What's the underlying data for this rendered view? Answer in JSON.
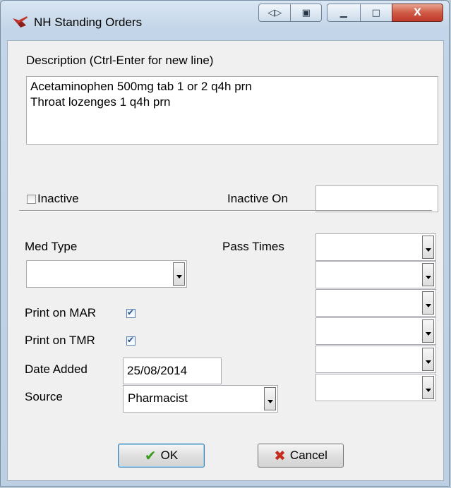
{
  "window": {
    "title": "NH Standing Orders",
    "buttons": {
      "restore_split": "◁▷",
      "copy": "▣",
      "minimize": "▁",
      "maximize": "□",
      "close": "X"
    }
  },
  "description": {
    "label": "Description  (Ctrl-Enter for new line)",
    "lines": [
      "Acetaminophen 500mg tab 1 or 2 q4h prn",
      "Throat lozenges 1 q4h prn"
    ]
  },
  "inactive": {
    "checkbox_label": "Inactive",
    "checked": false,
    "inactive_on_label": "Inactive On",
    "inactive_on_value": ""
  },
  "med_type": {
    "label": "Med Type",
    "value": ""
  },
  "pass_times": {
    "label": "Pass Times",
    "values": [
      "",
      "",
      "",
      "",
      "",
      ""
    ]
  },
  "print_on_mar": {
    "label": "Print on MAR",
    "checked": true
  },
  "print_on_tmr": {
    "label": "Print on TMR",
    "checked": true
  },
  "date_added": {
    "label": "Date Added",
    "value": "25/08/2014"
  },
  "source": {
    "label": "Source",
    "value": "Pharmacist"
  },
  "buttons": {
    "ok_label": "OK",
    "ok_icon": "check-icon",
    "cancel_label": "Cancel",
    "cancel_icon": "x-icon"
  },
  "colors": {
    "ok_check": "#3a9a1e",
    "cancel_x": "#c62a1c",
    "close_button": "#c0392b"
  }
}
